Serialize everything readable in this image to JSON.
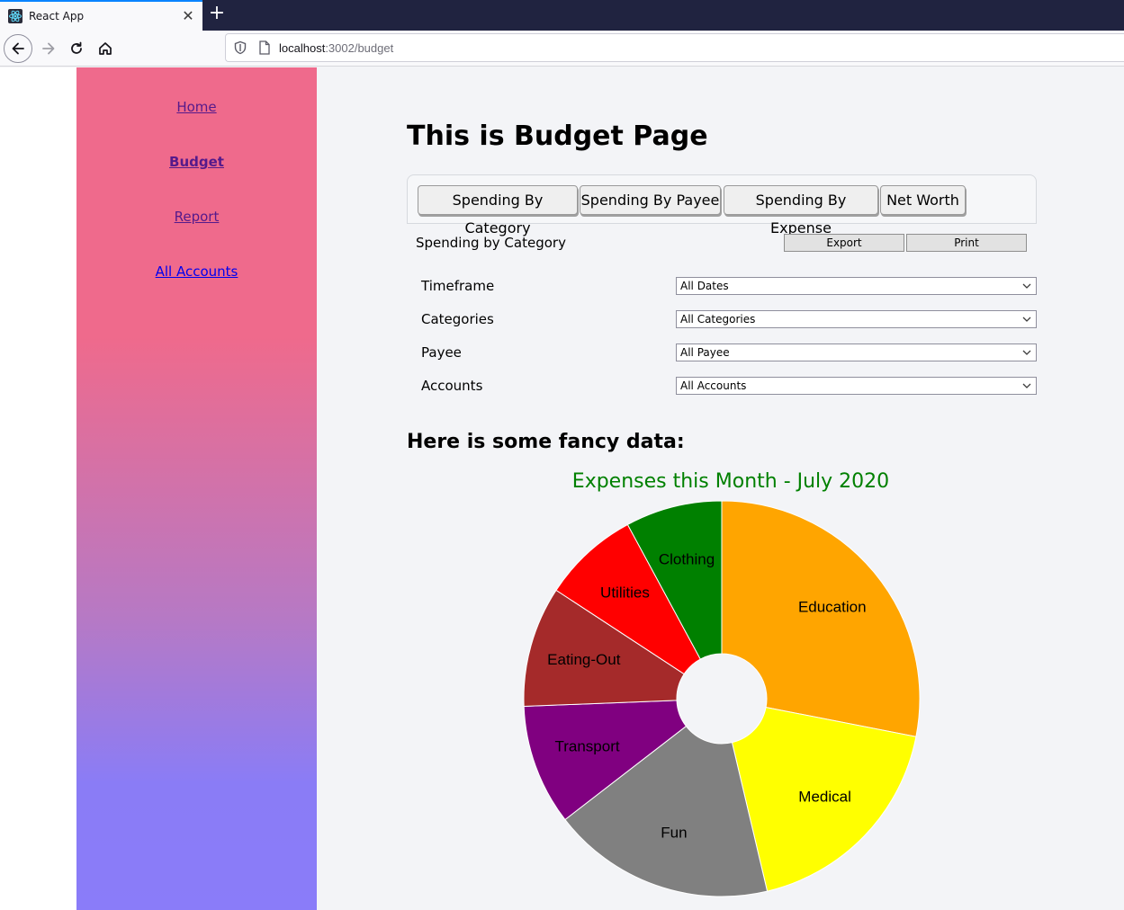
{
  "browser": {
    "tab_title": "React App",
    "url_host": "localhost",
    "url_rest": ":3002/budget"
  },
  "sidebar": {
    "links": [
      {
        "label": "Home"
      },
      {
        "label": "Budget"
      },
      {
        "label": "Report"
      },
      {
        "label": "All Accounts"
      }
    ]
  },
  "main": {
    "title": "This is Budget Page",
    "report_tabs": [
      {
        "label": "Spending By Category"
      },
      {
        "label": "Spending By Payee"
      },
      {
        "label": "Spending By Expense"
      },
      {
        "label": "Net Worth"
      }
    ],
    "section_heading": "Spending by Category",
    "export_label": "Export",
    "print_label": "Print",
    "filters": [
      {
        "label": "Timeframe",
        "value": "All Dates"
      },
      {
        "label": "Categories",
        "value": "All Categories"
      },
      {
        "label": "Payee",
        "value": "All Payee"
      },
      {
        "label": "Accounts",
        "value": "All Accounts"
      }
    ],
    "fancy_heading": "Here is some fancy data:"
  },
  "chart_data": {
    "type": "pie",
    "title": "Expenses this Month - July 2020",
    "donut": true,
    "title_color": "#008000",
    "categories": [
      "Education",
      "Medical",
      "Fun",
      "Transport",
      "Eating-Out",
      "Utilities",
      "Clothing"
    ],
    "values": [
      28.5,
      18.5,
      18.5,
      10,
      10,
      8,
      8
    ],
    "colors": [
      "#ffa500",
      "#ffff00",
      "#808080",
      "#800080",
      "#a52a2a",
      "#ff0000",
      "#008000"
    ]
  }
}
